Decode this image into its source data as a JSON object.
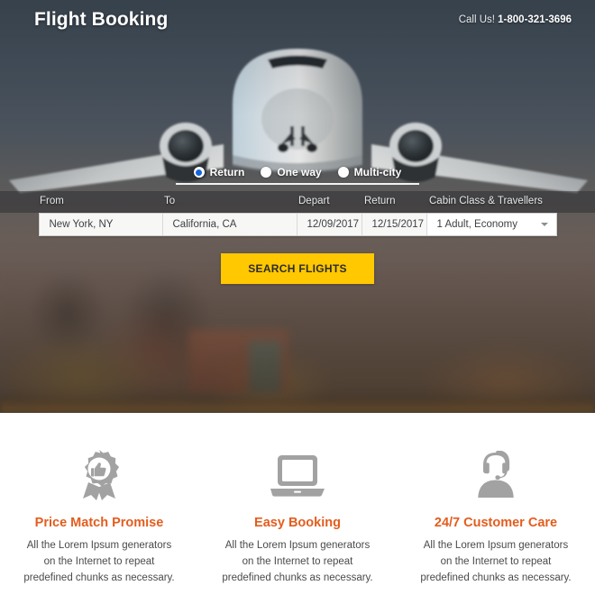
{
  "header": {
    "brand": "Flight Booking",
    "call_label": "Call Us!",
    "phone": "1-800-321-3696"
  },
  "booking": {
    "trip_types": [
      {
        "label": "Return",
        "selected": true
      },
      {
        "label": "One way",
        "selected": false
      },
      {
        "label": "Multi-city",
        "selected": false
      }
    ],
    "fields": [
      {
        "label": "From",
        "value": "New York, NY"
      },
      {
        "label": "To",
        "value": "California, CA"
      },
      {
        "label": "Depart",
        "value": "12/09/2017"
      },
      {
        "label": "Return",
        "value": "12/15/2017"
      },
      {
        "label": "Cabin Class & Travellers",
        "value": "1 Adult, Economy"
      }
    ],
    "search_button": "SEARCH FLIGHTS"
  },
  "features": [
    {
      "icon": "award-badge-thumbs-up-icon",
      "title": "Price Match Promise",
      "text": "All the Lorem Ipsum generators on the Internet to repeat predefined chunks as necessary."
    },
    {
      "icon": "laptop-icon",
      "title": "Easy Booking",
      "text": "All the Lorem Ipsum generators on the Internet to repeat predefined chunks as necessary."
    },
    {
      "icon": "headset-support-agent-icon",
      "title": "24/7 Customer Care",
      "text": "All the Lorem Ipsum generators on the Internet to repeat predefined chunks as necessary."
    }
  ],
  "colors": {
    "accent_orange": "#e35d1e",
    "button_yellow": "#ffc800",
    "radio_blue": "#1565d8",
    "icon_gray": "#a2a2a2"
  }
}
